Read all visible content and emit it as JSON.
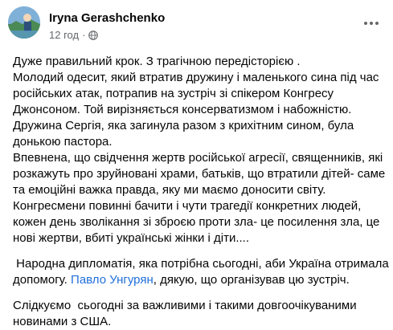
{
  "author": {
    "name": "Iryna Gerashchenko"
  },
  "meta": {
    "time": "12 год",
    "separator": "·",
    "audience_icon": "globe-icon"
  },
  "more_icon": "more-options-icon",
  "post": {
    "p1": [
      "Дуже правильний крок. З трагічною передісторією .",
      "Молодий одесит, який втратив дружину і маленького сина під час",
      "російських атак, потрапив на зустріч зі спікером Конгресу",
      "Джонсоном. Той вирізняється консерватизмом і набожністю.",
      "Дружина Сергія, яка загинула разом з крихітним сином, була",
      "донькою пастора.",
      "Впевнена, що свідчення жертв російської агресії, священників, які",
      "розкажуть про зруйновані храми, батьків, що втратили дітей- саме",
      "та емоційні важка правда, яку ми маємо доносити світу.",
      "Конгресмени повинні бачити і чути трагедії конкретних людей,",
      "кожен день зволікання зі зброєю проти зла- це посилення зла, це",
      "нові жертви, вбиті українські жінки і діти...."
    ],
    "p2_line1": " Народна дипломатія, яка потрібна сьогодні, аби Україна отримала",
    "p2_line2_before": "допомогу. ",
    "p2_link": "Павло Унгурян",
    "p2_line2_after": ", дякую, що організував цю зустріч.",
    "p3": [
      "Слідкуємо  сьогодні за важливими і такими довгоочікуваними",
      "новинами з США."
    ]
  }
}
